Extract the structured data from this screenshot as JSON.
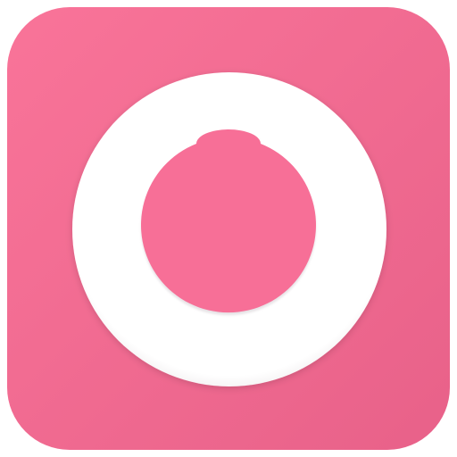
{
  "icon": {
    "name": "app-icon-pink-ring",
    "colors": {
      "tile_top": "#f97499",
      "tile_bottom": "#e86189",
      "ring": "#ffffff",
      "inner": "#f76f97",
      "inner_shadow": "#e7e3e6"
    }
  }
}
